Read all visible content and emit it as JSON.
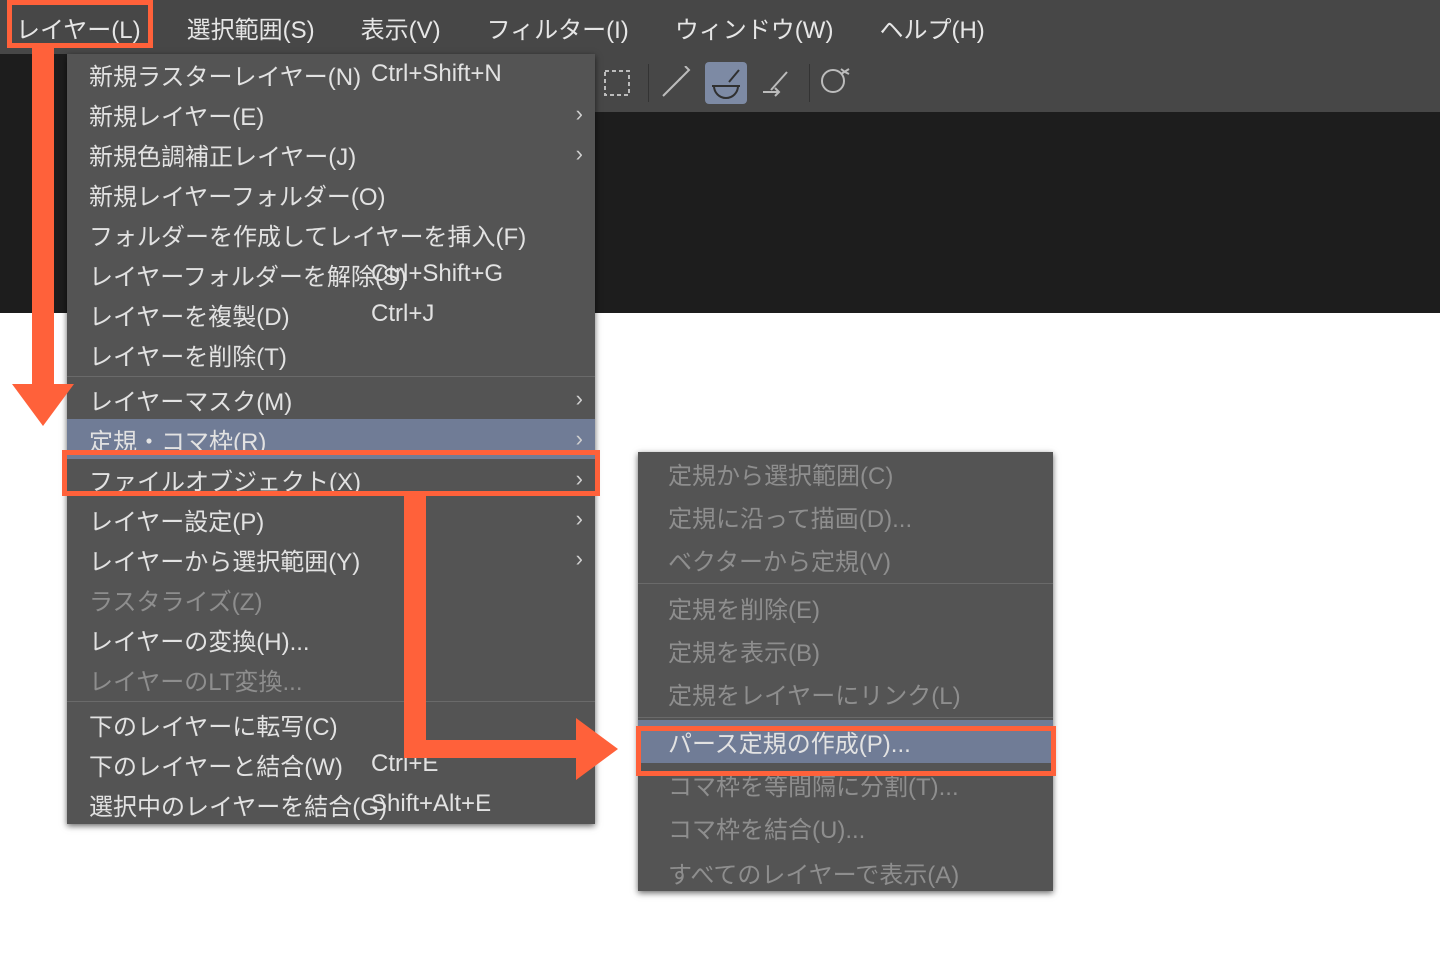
{
  "menubar": {
    "items": [
      {
        "label": "レイヤー(L)"
      },
      {
        "label": "選択範囲(S)"
      },
      {
        "label": "表示(V)"
      },
      {
        "label": "フィルター(I)"
      },
      {
        "label": "ウィンドウ(W)"
      },
      {
        "label": "ヘルプ(H)"
      }
    ]
  },
  "toolbar": {
    "icons": [
      "dashed-rect-icon",
      "brush-line-icon",
      "brush-bowl-icon",
      "brush-arrow-icon",
      "speech-icon"
    ]
  },
  "layerMenu": {
    "items": [
      {
        "label": "新規ラスターレイヤー(N)",
        "accel": "Ctrl+Shift+N",
        "sub": false,
        "disabled": false
      },
      {
        "label": "新規レイヤー(E)",
        "accel": "",
        "sub": true,
        "disabled": false
      },
      {
        "label": "新規色調補正レイヤー(J)",
        "accel": "",
        "sub": true,
        "disabled": false
      },
      {
        "label": "新規レイヤーフォルダー(O)",
        "accel": "",
        "sub": false,
        "disabled": false
      },
      {
        "label": "フォルダーを作成してレイヤーを挿入(F)",
        "accel": "",
        "sub": false,
        "disabled": false
      },
      {
        "label": "レイヤーフォルダーを解除(S)",
        "accel": "Ctrl+Shift+G",
        "sub": false,
        "disabled": false
      },
      {
        "label": "レイヤーを複製(D)",
        "accel": "Ctrl+J",
        "sub": false,
        "disabled": false
      },
      {
        "label": "レイヤーを削除(T)",
        "accel": "",
        "sub": false,
        "disabled": false
      },
      {
        "sep": true
      },
      {
        "label": "レイヤーマスク(M)",
        "accel": "",
        "sub": true,
        "disabled": false
      },
      {
        "label": "定規・コマ枠(R)",
        "accel": "",
        "sub": true,
        "disabled": false,
        "hl": true
      },
      {
        "label": "ファイルオブジェクト(X)",
        "accel": "",
        "sub": true,
        "disabled": false
      },
      {
        "label": "レイヤー設定(P)",
        "accel": "",
        "sub": true,
        "disabled": false
      },
      {
        "label": "レイヤーから選択範囲(Y)",
        "accel": "",
        "sub": true,
        "disabled": false
      },
      {
        "label": "ラスタライズ(Z)",
        "accel": "",
        "sub": false,
        "disabled": true
      },
      {
        "label": "レイヤーの変換(H)...",
        "accel": "",
        "sub": false,
        "disabled": false
      },
      {
        "label": "レイヤーのLT変換...",
        "accel": "",
        "sub": false,
        "disabled": true
      },
      {
        "sep": true
      },
      {
        "label": "下のレイヤーに転写(C)",
        "accel": "",
        "sub": false,
        "disabled": false
      },
      {
        "label": "下のレイヤーと結合(W)",
        "accel": "Ctrl+E",
        "sub": false,
        "disabled": false
      },
      {
        "label": "選択中のレイヤーを結合(G)",
        "accel": "Shift+Alt+E",
        "sub": false,
        "disabled": false
      }
    ]
  },
  "rulerSubmenu": {
    "items": [
      {
        "label": "定規から選択範囲(C)",
        "disabled": true
      },
      {
        "label": "定規に沿って描画(D)...",
        "disabled": true
      },
      {
        "label": "ベクターから定規(V)",
        "disabled": true
      },
      {
        "sep": true
      },
      {
        "label": "定規を削除(E)",
        "disabled": true
      },
      {
        "label": "定規を表示(B)",
        "disabled": true
      },
      {
        "label": "定規をレイヤーにリンク(L)",
        "disabled": true
      },
      {
        "sep": true
      },
      {
        "label": "パース定規の作成(P)...",
        "disabled": false,
        "hl": true
      },
      {
        "label": "コマ枠を等間隔に分割(T)...",
        "disabled": true
      },
      {
        "label": "コマ枠を結合(U)...",
        "disabled": true
      },
      {
        "label": "すべてのレイヤーで表示(A)",
        "disabled": true,
        "cut": true
      }
    ]
  },
  "submenuArrowGlyph": "›"
}
